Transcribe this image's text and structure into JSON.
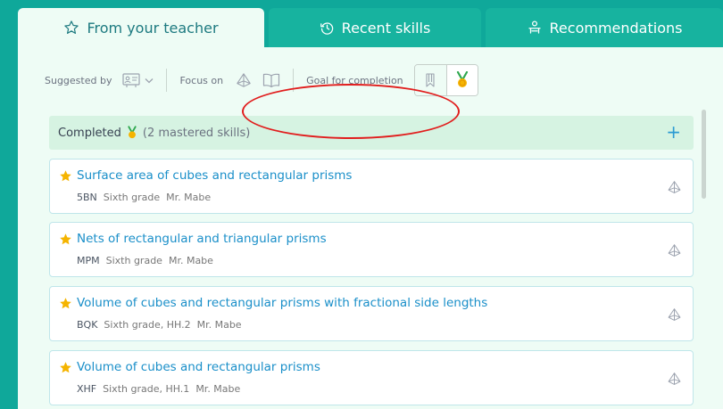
{
  "tabs": [
    {
      "label": "From your teacher",
      "icon": "star-outline-icon",
      "active": true
    },
    {
      "label": "Recent skills",
      "icon": "history-clock-icon",
      "active": false
    },
    {
      "label": "Recommendations",
      "icon": "recommendations-icon",
      "active": false
    }
  ],
  "toolbar": {
    "suggested_by_label": "Suggested by",
    "focus_on_label": "Focus on",
    "goal_label": "Goal for completion"
  },
  "completed": {
    "label": "Completed",
    "count_text": "(2 mastered skills)",
    "expand_symbol": "+"
  },
  "skills": [
    {
      "title": "Surface area of cubes and rectangular prisms",
      "code": "5BN",
      "grade": "Sixth grade",
      "teacher": "Mr. Mabe"
    },
    {
      "title": "Nets of rectangular and triangular prisms",
      "code": "MPM",
      "grade": "Sixth grade",
      "teacher": "Mr. Mabe"
    },
    {
      "title": "Volume of cubes and rectangular prisms with fractional side lengths",
      "code": "BQK",
      "grade": "Sixth grade, HH.2",
      "teacher": "Mr. Mabe"
    },
    {
      "title": "Volume of cubes and rectangular prisms",
      "code": "XHF",
      "grade": "Sixth grade, HH.1",
      "teacher": "Mr. Mabe"
    }
  ],
  "colors": {
    "frame": "#0fa89a",
    "panel": "#eefcf5",
    "link": "#1a8fc9",
    "star": "#f5b400",
    "annotation": "#e11d1d"
  }
}
